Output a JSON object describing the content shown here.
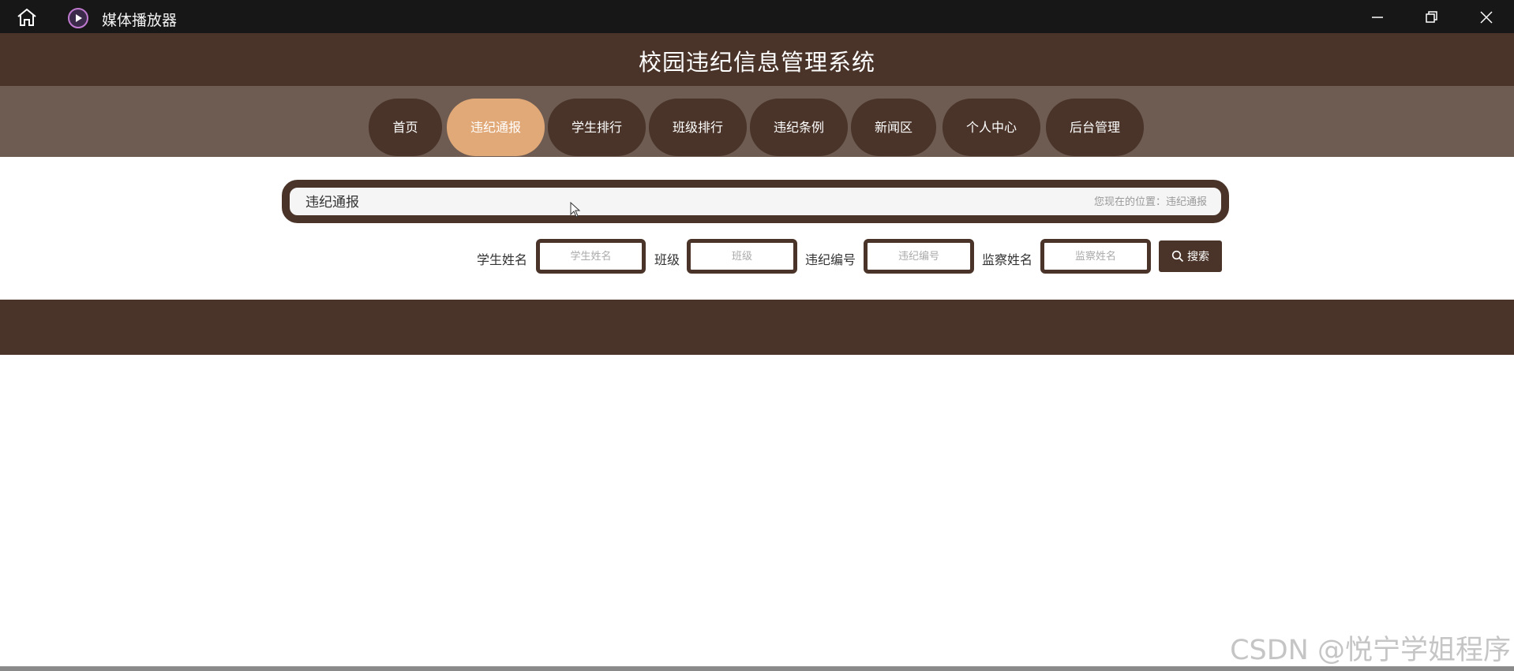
{
  "window": {
    "title": "媒体播放器",
    "icons": [
      "home-icon",
      "media-player-icon",
      "minimize-icon",
      "restore-icon",
      "close-icon"
    ]
  },
  "header": {
    "title": "校园违纪信息管理系统"
  },
  "nav": {
    "items": [
      {
        "label": "首页",
        "active": false
      },
      {
        "label": "违纪通报",
        "active": true
      },
      {
        "label": "学生排行",
        "active": false
      },
      {
        "label": "班级排行",
        "active": false
      },
      {
        "label": "违纪条例",
        "active": false
      },
      {
        "label": "新闻区",
        "active": false
      },
      {
        "label": "个人中心",
        "active": false
      },
      {
        "label": "后台管理",
        "active": false
      }
    ]
  },
  "breadcrumb": {
    "title": "违纪通报",
    "location_prefix": "您现在的位置：",
    "location_current": "违纪通报"
  },
  "search": {
    "student_name_label": "学生姓名",
    "student_name_placeholder": "学生姓名",
    "class_label": "班级",
    "class_placeholder": "班级",
    "violation_no_label": "违纪编号",
    "violation_no_placeholder": "违纪编号",
    "inspector_label": "监察姓名",
    "inspector_placeholder": "监察姓名",
    "button_label": "搜索"
  },
  "watermark": "CSDN @悦宁学姐程序",
  "colors": {
    "primary": "#4a3429",
    "nav_bar": "#6e5c52",
    "active_tab": "#e2a978",
    "titlebar": "#171717"
  }
}
